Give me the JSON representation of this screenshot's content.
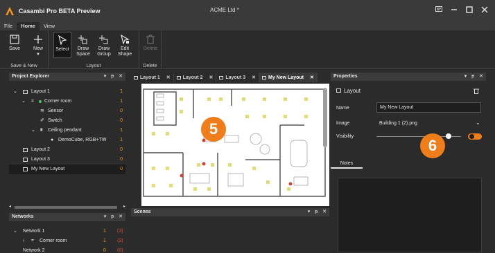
{
  "app": {
    "title": "Casambi Pro BETA Preview",
    "document_title": "ACME Ltd *"
  },
  "menu": {
    "tabs": [
      {
        "label": "File"
      },
      {
        "label": "Home"
      },
      {
        "label": "View"
      }
    ],
    "active_tab": "Home"
  },
  "ribbon": {
    "save": "Save",
    "new": "New",
    "group_save_new": "Save & New",
    "select": "Select",
    "draw_space": "Draw\nSpace",
    "draw_group": "Draw\nGroup",
    "edit_shape": "Edit\nShape",
    "group_layout": "Layout",
    "delete": "Delete",
    "group_delete": "Delete"
  },
  "project_explorer": {
    "title": "Project Explorer",
    "items": [
      {
        "label": "Layout 1",
        "count": "1"
      },
      {
        "label": "Corner room",
        "count": "1"
      },
      {
        "label": "Sensor",
        "count": "0"
      },
      {
        "label": "Switch",
        "count": "0"
      },
      {
        "label": "Ceiling pendant",
        "count": "1"
      },
      {
        "label": "DemoCube, RGB+TW",
        "count": "1"
      },
      {
        "label": "Layout 2",
        "count": "0"
      },
      {
        "label": "Layout 3",
        "count": "0"
      },
      {
        "label": "My New Layout",
        "count": "0"
      }
    ]
  },
  "networks": {
    "title": "Networks",
    "items": [
      {
        "label": "Network 1",
        "count": "1",
        "extra": "(3)"
      },
      {
        "label": "Corner room",
        "count": "1",
        "extra": "(3)"
      },
      {
        "label": "Network 2",
        "count": "0",
        "extra": "(0)"
      }
    ]
  },
  "doc_tabs": [
    {
      "label": "Layout 1"
    },
    {
      "label": "Layout 2"
    },
    {
      "label": "Layout 3"
    },
    {
      "label": "My New Layout"
    }
  ],
  "scenes": {
    "title": "Scenes"
  },
  "properties": {
    "title": "Properties",
    "heading": "Layout",
    "name_label": "Name",
    "name_value": "My New Layout",
    "image_label": "Image",
    "image_value": "Building 1 (2).png",
    "visibility_label": "Visibility",
    "visibility_level": 0.85,
    "notes_tab": "Notes"
  },
  "callouts": {
    "canvas": "5",
    "properties": "6"
  },
  "colors": {
    "accent": "#ef7d1a",
    "count": "#f29b1d",
    "background": "#2b2b2b",
    "panel_header": "#3c3c3c"
  }
}
